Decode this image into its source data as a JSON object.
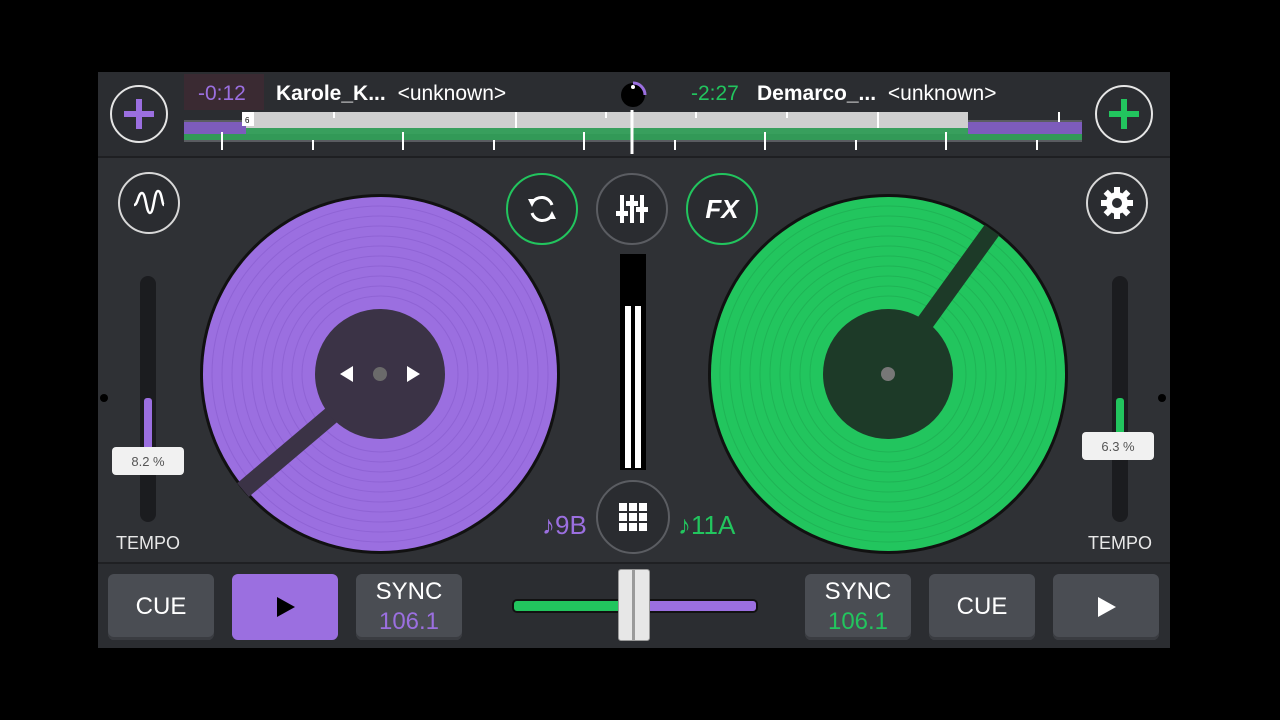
{
  "deck_a": {
    "time": "-0:12",
    "title": "Karole_K...",
    "artist": "<unknown>",
    "tempo": "8.2 %",
    "tempo_level": 0.5,
    "key": "♪9B",
    "cue_label": "CUE",
    "sync_label": "SYNC",
    "bpm": "106.1",
    "color": "#9b6fe0"
  },
  "deck_b": {
    "time": "-2:27",
    "title": "Demarco_...",
    "artist": "<unknown>",
    "tempo": "6.3 %",
    "tempo_level": 0.55,
    "key": "♪11A",
    "cue_label": "CUE",
    "sync_label": "SYNC",
    "bpm": "106.1",
    "color": "#22c55e"
  },
  "tempo_label": "TEMPO",
  "center": {
    "fx_label": "FX",
    "icons": [
      "sync-loop-icon",
      "mixer-icon",
      "fx-icon",
      "grid-icon"
    ],
    "cue_marker": "6"
  },
  "crossfader_position": 0.5
}
